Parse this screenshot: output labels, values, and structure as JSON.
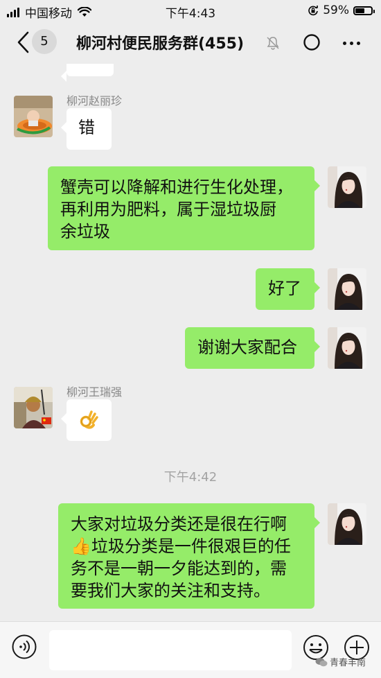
{
  "status_bar": {
    "carrier": "中国移动",
    "time": "下午4:43",
    "battery_percent": "59%",
    "battery_level": 0.59
  },
  "nav": {
    "back_badge": "5",
    "title": "柳河村便民服务群(455)"
  },
  "messages": [
    {
      "type": "text",
      "side": "left",
      "sender": "柳河赵丽珍",
      "text": "错"
    },
    {
      "type": "text",
      "side": "right",
      "lines": [
        "蟹壳可以降解和进行生化处理，",
        "再利用为肥料，属于湿垃圾厨",
        "余垃圾"
      ]
    },
    {
      "type": "text",
      "side": "right",
      "text": "好了"
    },
    {
      "type": "text",
      "side": "right",
      "text": "谢谢大家配合"
    },
    {
      "type": "emoji",
      "side": "left",
      "sender": "柳河王瑞强",
      "emoji": "ok-hand"
    },
    {
      "type": "time",
      "text": "下午4:42"
    },
    {
      "type": "text",
      "side": "right",
      "lines": [
        "大家对垃圾分类还是很在行啊",
        "👍垃圾分类是一件很艰巨的任",
        "务不是一朝一夕能达到的，需",
        "要我们大家的关注和支持。"
      ]
    }
  ],
  "watermark": "青春丰南",
  "colors": {
    "background": "#ededed",
    "bubble_green": "#95ec69",
    "bubble_white": "#ffffff"
  }
}
